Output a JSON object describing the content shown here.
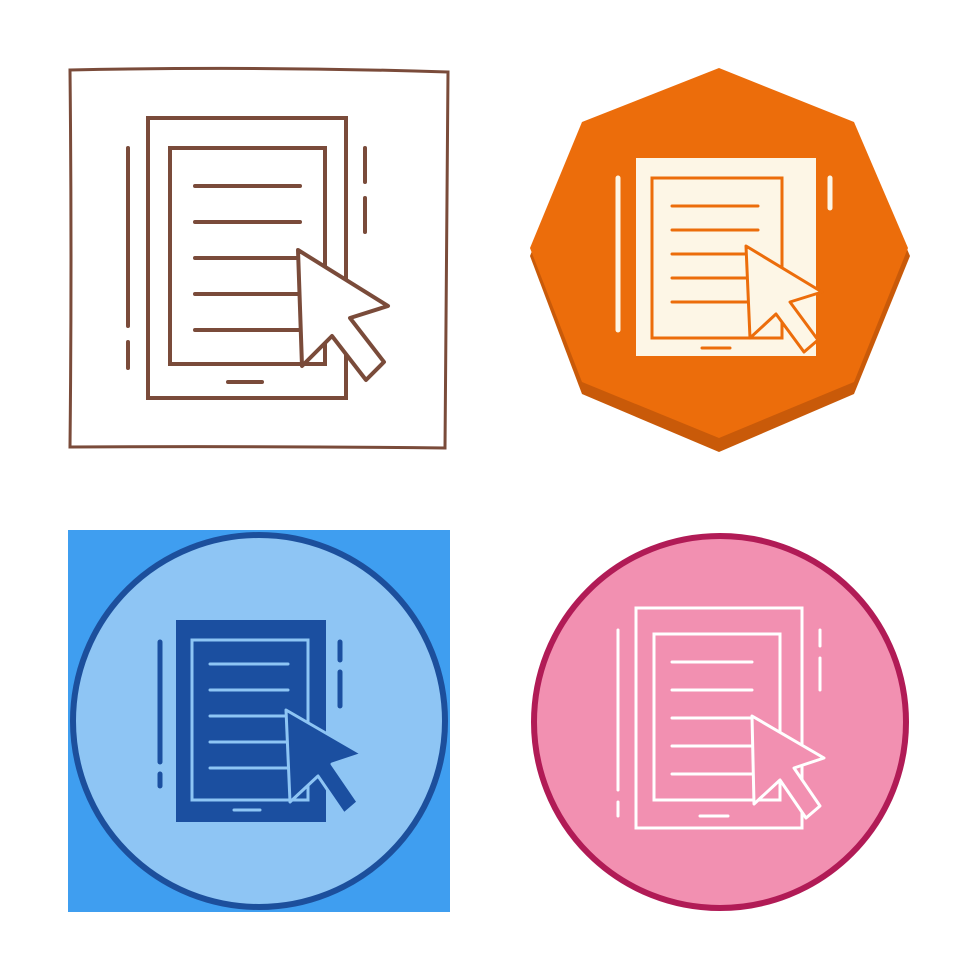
{
  "icons": [
    {
      "id": "outline",
      "badge": "square-sketch",
      "colors": {
        "background": "#ffffff",
        "border": "#7a4b3a",
        "stroke": "#7a4b3a",
        "fill": "#ffffff"
      }
    },
    {
      "id": "octagon",
      "badge": "octagon",
      "colors": {
        "background": "#ec6d0b",
        "shadow": "#c95a09",
        "stroke": "#ec6d0b",
        "fill": "#fdf6e6"
      }
    },
    {
      "id": "blue-solid",
      "badge": "square-with-circle",
      "colors": {
        "square": "#3f9ef0",
        "circle": "#8ec5f4",
        "ring": "#1c4f9c",
        "fill": "#1b4fa0",
        "lines": "#8ec5f4"
      }
    },
    {
      "id": "pink-outline",
      "badge": "circle",
      "colors": {
        "circle": "#f290b1",
        "ring": "#b11b56",
        "stroke": "#ffffff"
      }
    }
  ],
  "icon_glyph": "tablet-document-cursor-icon"
}
